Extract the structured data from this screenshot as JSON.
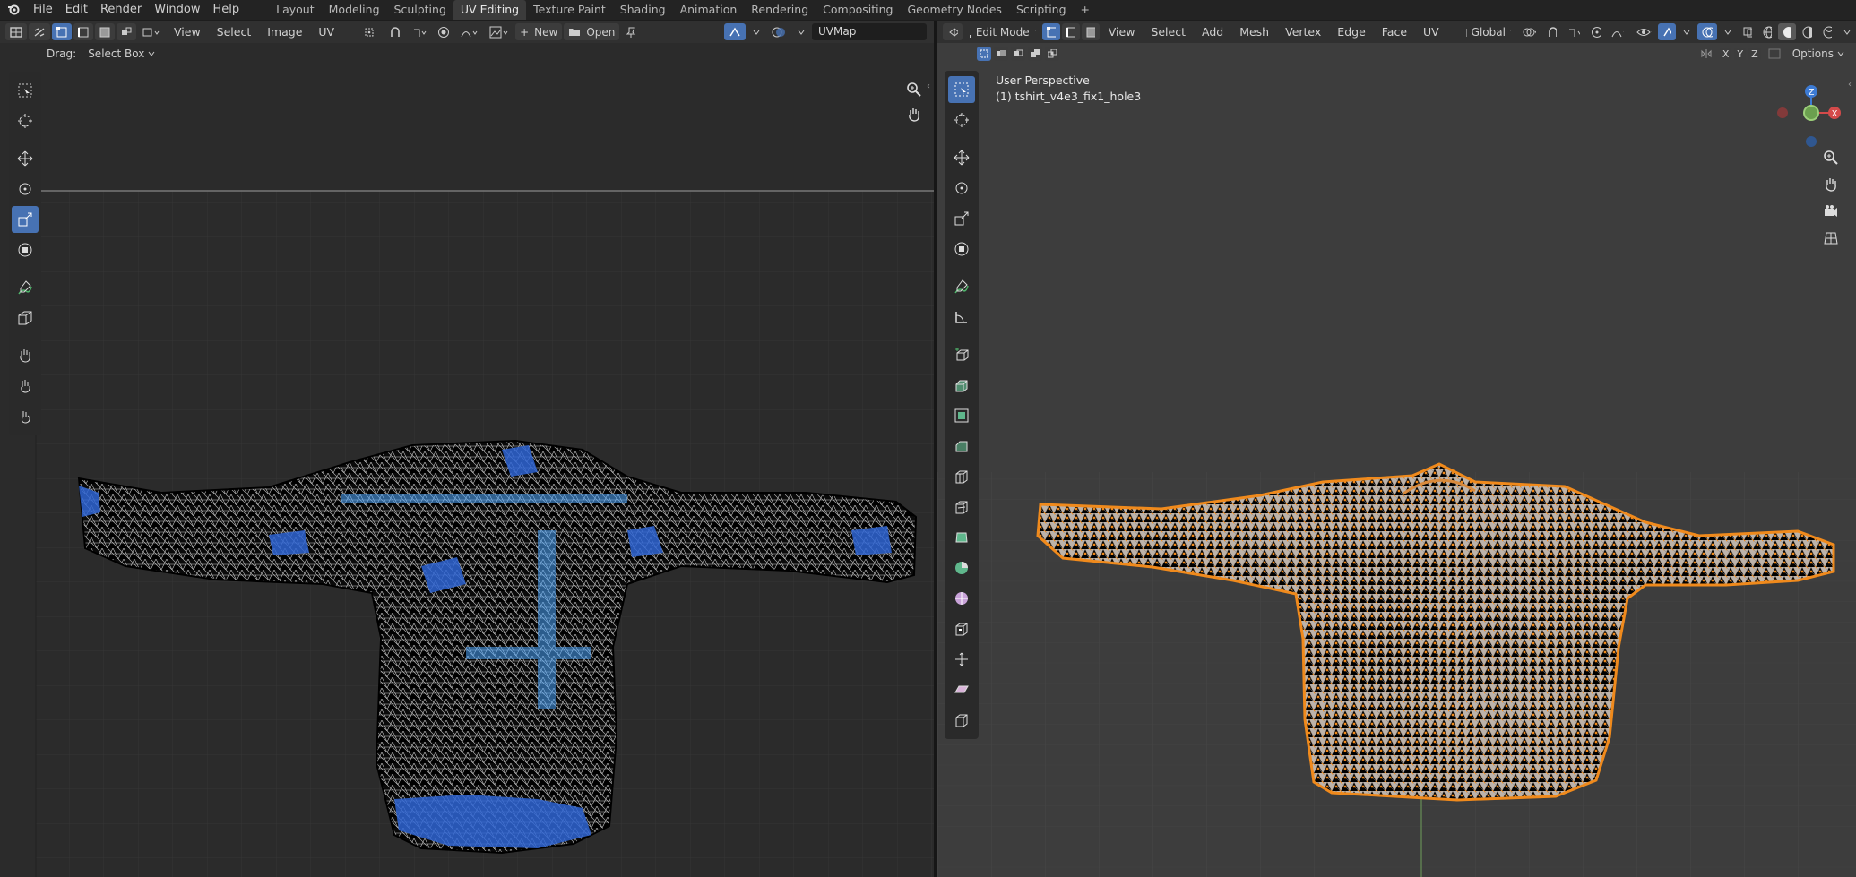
{
  "topbar": {
    "menus": [
      "File",
      "Edit",
      "Render",
      "Window",
      "Help"
    ],
    "workspaces": [
      "Layout",
      "Modeling",
      "Sculpting",
      "UV Editing",
      "Texture Paint",
      "Shading",
      "Animation",
      "Rendering",
      "Compositing",
      "Geometry Nodes",
      "Scripting"
    ],
    "active_workspace": "UV Editing",
    "add_tab": "+"
  },
  "uv_editor": {
    "menus": [
      "View",
      "Select",
      "Image",
      "UV"
    ],
    "new_label": "New",
    "open_label": "Open",
    "uvmap_value": "UVMap",
    "drag_label": "Drag:",
    "drag_mode": "Select Box"
  },
  "viewport": {
    "mode": "Edit Mode",
    "menus": [
      "View",
      "Select",
      "Add",
      "Mesh",
      "Vertex",
      "Edge",
      "Face",
      "UV"
    ],
    "transform_orientation": "Global",
    "options_label": "Options",
    "axes": [
      "X",
      "Y",
      "Z"
    ],
    "perspective_label": "User Perspective",
    "object_label": "(1) tshirt_v4e3_fix1_hole3",
    "gizmo": {
      "z": "Z",
      "x": "X"
    }
  },
  "colors": {
    "accent": "#4772b3",
    "mesh_orange": "#f08a1c",
    "uv_blue": "#3a6fd6"
  }
}
